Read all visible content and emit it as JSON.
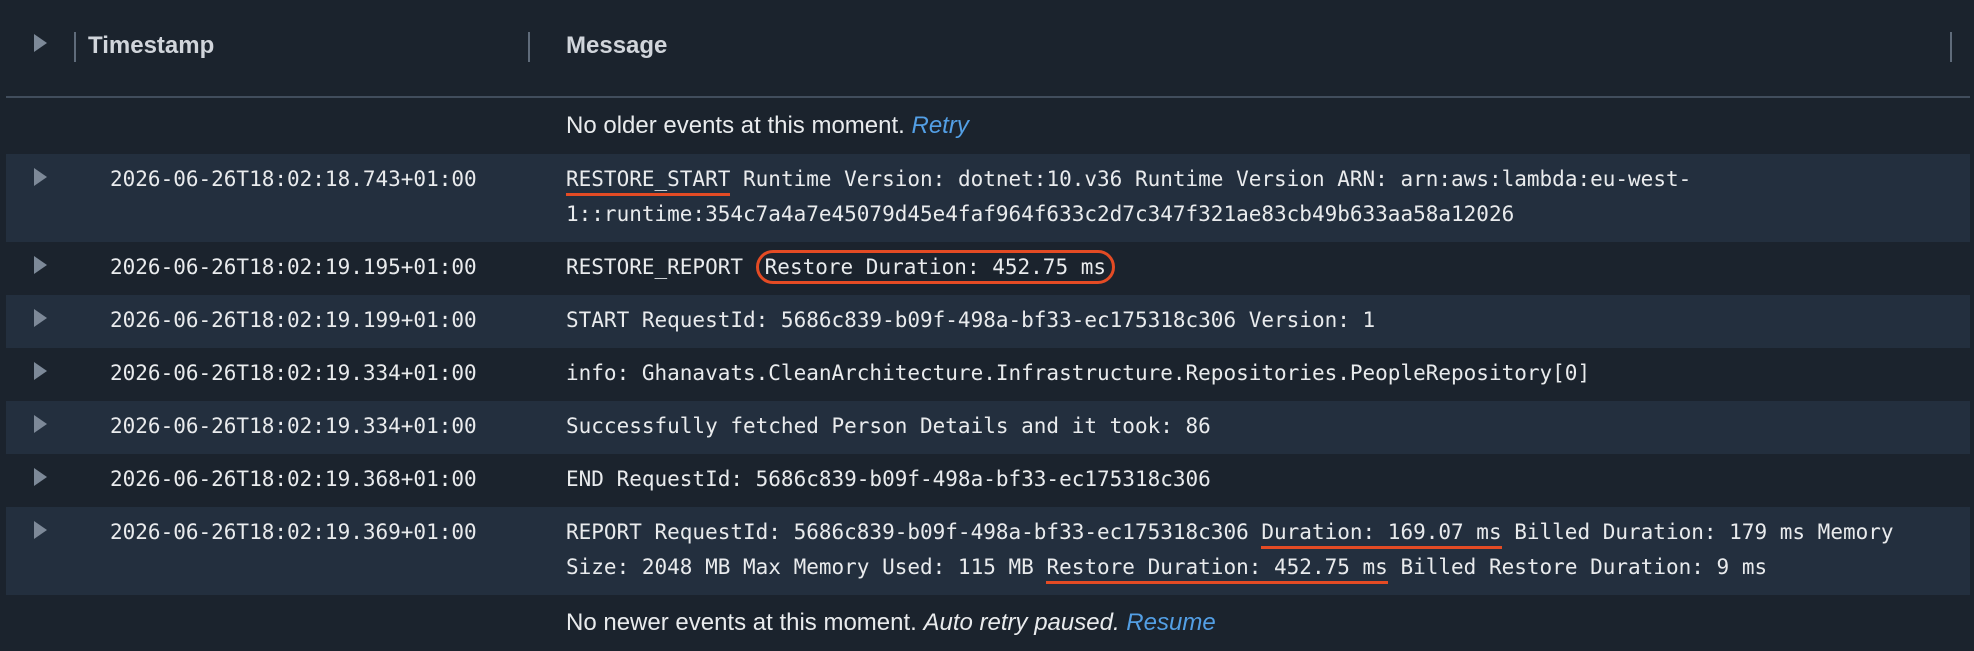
{
  "header": {
    "timestamp_label": "Timestamp",
    "message_label": "Message"
  },
  "status": {
    "older_text": "No older events at this moment.",
    "older_link": "Retry",
    "newer_text": "No newer events at this moment.",
    "newer_italic": "Auto retry paused.",
    "newer_link": "Resume"
  },
  "events": [
    {
      "timestamp": "2026-06-26T18:02:18.743+01:00",
      "parts": [
        {
          "text": "RESTORE_START",
          "mark": "underline"
        },
        {
          "text": " Runtime Version: dotnet:10.v36 Runtime Version ARN: arn:aws:lambda:eu-west-1::runtime:354c7a4a7e45079d45e4faf964f633c2d7c347f321ae83cb49b633aa58a12026"
        }
      ]
    },
    {
      "timestamp": "2026-06-26T18:02:19.195+01:00",
      "parts": [
        {
          "text": "RESTORE_REPORT "
        },
        {
          "text": "Restore Duration: 452.75 ms",
          "mark": "circle"
        }
      ]
    },
    {
      "timestamp": "2026-06-26T18:02:19.199+01:00",
      "parts": [
        {
          "text": "START RequestId: 5686c839-b09f-498a-bf33-ec175318c306 Version: 1"
        }
      ]
    },
    {
      "timestamp": "2026-06-26T18:02:19.334+01:00",
      "parts": [
        {
          "text": "info: Ghanavats.CleanArchitecture.Infrastructure.Repositories.PeopleRepository[0]"
        }
      ]
    },
    {
      "timestamp": "2026-06-26T18:02:19.334+01:00",
      "parts": [
        {
          "text": "Successfully fetched Person Details and it took: 86"
        }
      ]
    },
    {
      "timestamp": "2026-06-26T18:02:19.368+01:00",
      "parts": [
        {
          "text": "END RequestId: 5686c839-b09f-498a-bf33-ec175318c306"
        }
      ]
    },
    {
      "timestamp": "2026-06-26T18:02:19.369+01:00",
      "parts": [
        {
          "text": "REPORT RequestId: 5686c839-b09f-498a-bf33-ec175318c306 "
        },
        {
          "text": "Duration: 169.07 ms",
          "mark": "underline"
        },
        {
          "text": " Billed Duration: 179 ms Memory Size: 2048 MB Max Memory Used: 115 MB "
        },
        {
          "text": "Restore Duration: 452.75 ms",
          "mark": "underline"
        },
        {
          "text": " Billed Restore Duration: 9 ms"
        }
      ]
    }
  ],
  "colors": {
    "background": "#1b232d",
    "row_alt": "#232f3e",
    "link": "#539fe5",
    "annotation": "#e44b24"
  }
}
